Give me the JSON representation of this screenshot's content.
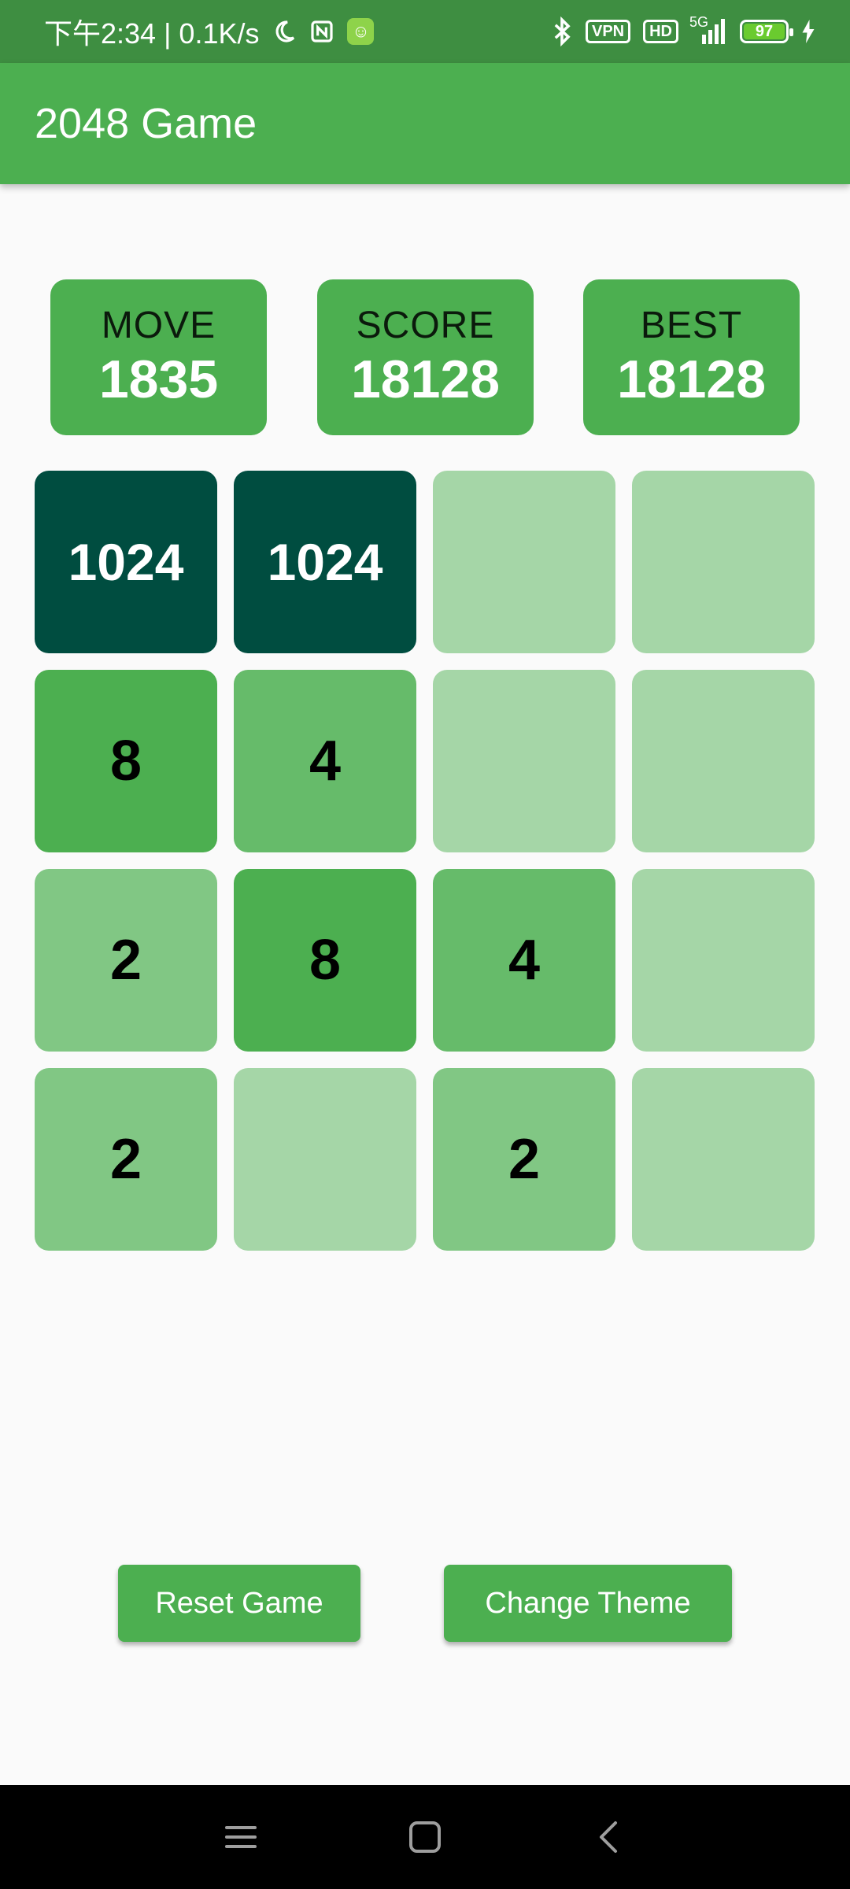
{
  "status_bar": {
    "time": "下午2:34 | 0.1K/s",
    "vpn": "VPN",
    "hd": "HD",
    "network": "5G",
    "battery": "97"
  },
  "app_bar": {
    "title": "2048 Game"
  },
  "scores": [
    {
      "label": "MOVE",
      "value": "1835"
    },
    {
      "label": "SCORE",
      "value": "18128"
    },
    {
      "label": "BEST",
      "value": "18128"
    }
  ],
  "board": {
    "rows": [
      [
        "1024",
        "1024",
        "",
        ""
      ],
      [
        "8",
        "4",
        "",
        ""
      ],
      [
        "2",
        "8",
        "4",
        ""
      ],
      [
        "2",
        "",
        "2",
        ""
      ]
    ],
    "colors": {
      "empty": "#a5d6a7",
      "2": "#81c784",
      "4": "#66bb6a",
      "8": "#4caf50",
      "1024": "#004d40"
    },
    "text_colors": {
      "dark": "#000000",
      "light": "#ffffff"
    }
  },
  "buttons": {
    "reset": "Reset Game",
    "theme": "Change Theme"
  },
  "nav_bar": {
    "icons": [
      "menu-icon",
      "home-icon",
      "back-icon"
    ]
  }
}
